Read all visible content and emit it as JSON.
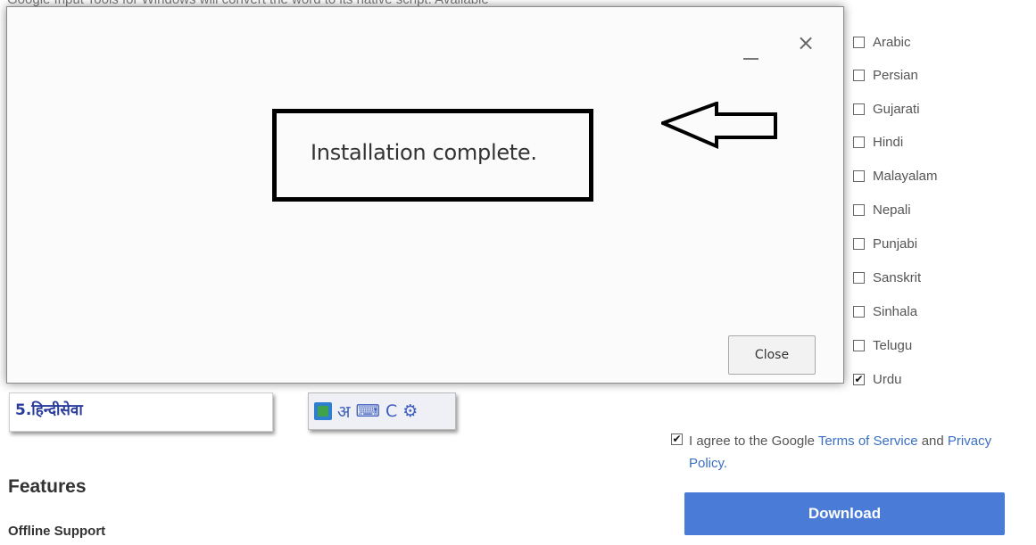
{
  "background": {
    "top_text": "Google Input Tools for Windows will convert the word to its native script. Available",
    "languages": [
      {
        "label": "Arabic",
        "checked": false
      },
      {
        "label": "Persian",
        "checked": false
      },
      {
        "label": "Gujarati",
        "checked": false
      },
      {
        "label": "Hindi",
        "checked": false
      },
      {
        "label": "Malayalam",
        "checked": false
      },
      {
        "label": "Nepali",
        "checked": false
      },
      {
        "label": "Punjabi",
        "checked": false
      },
      {
        "label": "Sanskrit",
        "checked": false
      },
      {
        "label": "Sinhala",
        "checked": false
      },
      {
        "label": "Telugu",
        "checked": false
      },
      {
        "label": "Urdu",
        "checked": true
      }
    ],
    "agree": {
      "checked": true,
      "prefix": "I agree to the Google ",
      "terms_link": "Terms of Service",
      "middle": " and ",
      "privacy_link": "Privacy Policy."
    },
    "download_label": "Download",
    "hindi_sample": "5.हिन्दीसेवा",
    "toolbar_glyph_letter": "अ",
    "toolbar_glyph_c": "C",
    "features_heading": "Features",
    "offline_heading": "Offline Support"
  },
  "dialog": {
    "message": "Installation complete.",
    "close_label": "Close",
    "close_icon": "×"
  },
  "colors": {
    "link": "#3b6fc4",
    "download_bg": "#4a7bd6"
  }
}
